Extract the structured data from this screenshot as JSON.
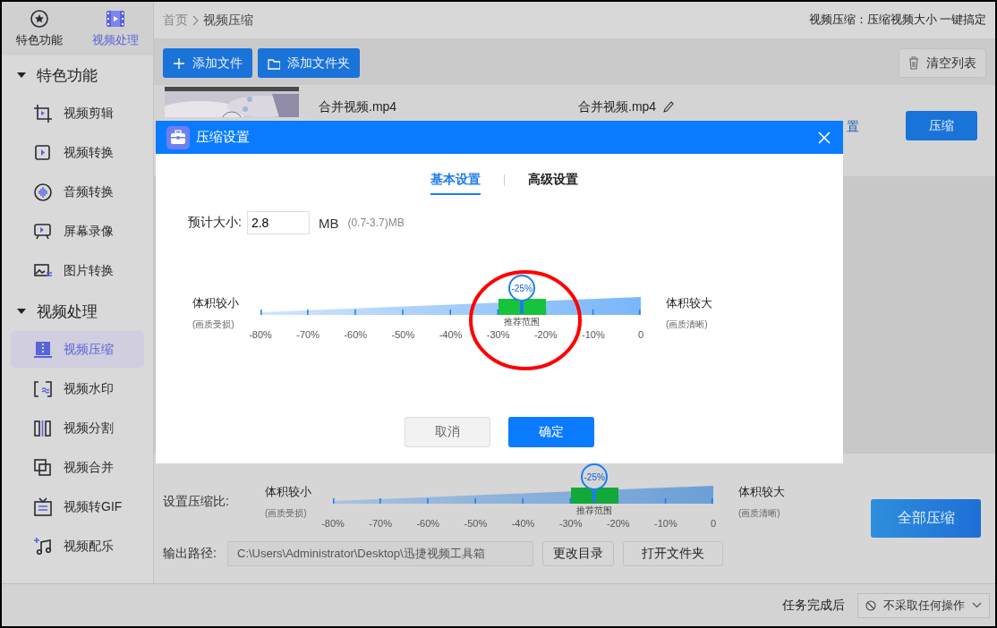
{
  "sidebar": {
    "tabs": [
      {
        "label": "特色功能",
        "selected": false
      },
      {
        "label": "视频处理",
        "selected": true
      }
    ],
    "groups": [
      {
        "label": "特色功能",
        "expanded": true,
        "items": [
          {
            "label": "视频剪辑",
            "selected": false
          },
          {
            "label": "视频转换",
            "selected": false
          },
          {
            "label": "音频转换",
            "selected": false
          },
          {
            "label": "屏幕录像",
            "selected": false
          },
          {
            "label": "图片转换",
            "selected": false
          }
        ]
      },
      {
        "label": "视频处理",
        "expanded": true,
        "items": [
          {
            "label": "视频压缩",
            "selected": true
          },
          {
            "label": "视频水印",
            "selected": false
          },
          {
            "label": "视频分割",
            "selected": false
          },
          {
            "label": "视频合并",
            "selected": false
          },
          {
            "label": "视频转GIF",
            "selected": false
          },
          {
            "label": "视频配乐",
            "selected": false
          }
        ]
      }
    ]
  },
  "breadcrumb": [
    "首页",
    "视频压缩"
  ],
  "tagline": "视频压缩：压缩视频大小 一键搞定",
  "toolbar": {
    "buttons": [
      {
        "label": "添加文件"
      },
      {
        "label": "添加文件夹"
      }
    ],
    "clear_button": "清空列表"
  },
  "file": {
    "source_name": "合并视频.mp4",
    "output_name": "合并视频.mp4",
    "settings_link": "置",
    "compress_button": "压缩"
  },
  "dialog": {
    "title": "压缩设置",
    "tabs": [
      {
        "label": "基本设置",
        "selected": true
      },
      {
        "label": "高级设置",
        "selected": false
      }
    ],
    "size_label": "预计大小:",
    "size_value": "2.8",
    "size_unit": "MB",
    "size_range": "(0.7-3.7)MB",
    "slider": {
      "left_label": "体积较小",
      "left_note": "(画质受损)",
      "right_label": "体积较大",
      "right_note": "(画质清晰)",
      "level": 0.6875,
      "value_label": "-25%",
      "recommended_label": "推荐范围",
      "ticks": [
        "-80%",
        "-70%",
        "-60%",
        "-50%",
        "-40%",
        "-30%",
        "-20%",
        "-10%",
        "0"
      ]
    },
    "cancel_button": "取消",
    "confirm_button": "确定"
  },
  "annotation": {
    "kind": "circle",
    "color": "#ff0000"
  },
  "bottom": {
    "ratio_label": "设置压缩比:",
    "slider": {
      "left_label": "体积较小",
      "left_note": "(画质受损)",
      "right_label": "体积较大",
      "right_note": "(画质清晰)",
      "level": 0.6875,
      "value_label": "-25%",
      "recommended_label": "推荐范围",
      "ticks": [
        "-80%",
        "-70%",
        "-60%",
        "-50%",
        "-40%",
        "-30%",
        "-20%",
        "-10%",
        "0"
      ]
    },
    "output_label": "输出路径:",
    "output_path": "C:\\Users\\Administrator\\Desktop\\迅捷视频工具箱",
    "change_dir_button": "更改目录",
    "open_folder_button": "打开文件夹",
    "compress_all_button": "全部压缩"
  },
  "footer": {
    "label": "任务完成后",
    "select_value": "不采取任何操作"
  }
}
